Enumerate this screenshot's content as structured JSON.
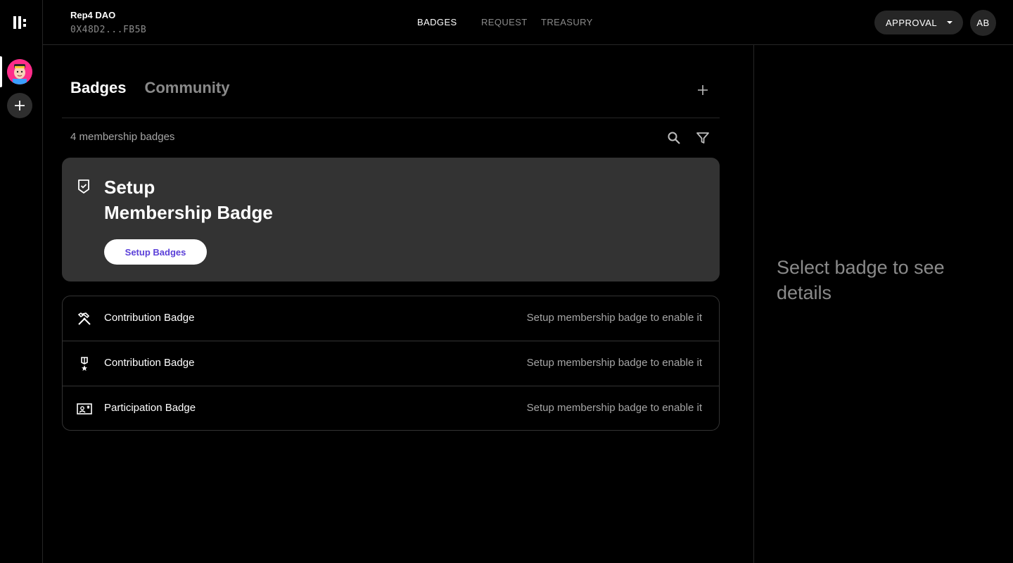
{
  "app": {
    "dao_name": "Rep4 DAO",
    "dao_address": "0X48D2...FB5B"
  },
  "nav": {
    "badges": "BADGES",
    "request": "REQUEST",
    "treasury": "TREASURY"
  },
  "header": {
    "approval_label": "APPROVAL",
    "user_initials": "AB"
  },
  "main": {
    "tabs": [
      {
        "label": "Badges"
      },
      {
        "label": "Community"
      }
    ],
    "badge_count": "4 membership badges",
    "setup": {
      "title_line1": "Setup",
      "title_line2": "Membership Badge",
      "button_label": "Setup Badges"
    },
    "badges": [
      {
        "name": "Contribution Badge",
        "hint": "Setup membership badge to enable it",
        "icon": "tools-icon"
      },
      {
        "name": "Contribution Badge",
        "hint": "Setup membership badge to enable it",
        "icon": "medal-icon"
      },
      {
        "name": "Participation Badge",
        "hint": "Setup membership badge to enable it",
        "icon": "id-card-icon"
      }
    ]
  },
  "details": {
    "placeholder": "Select badge to see details"
  },
  "colors": {
    "accent": "#5a3fd8",
    "avatar_bg": "#ff2d8a",
    "card_bg": "#333333"
  }
}
